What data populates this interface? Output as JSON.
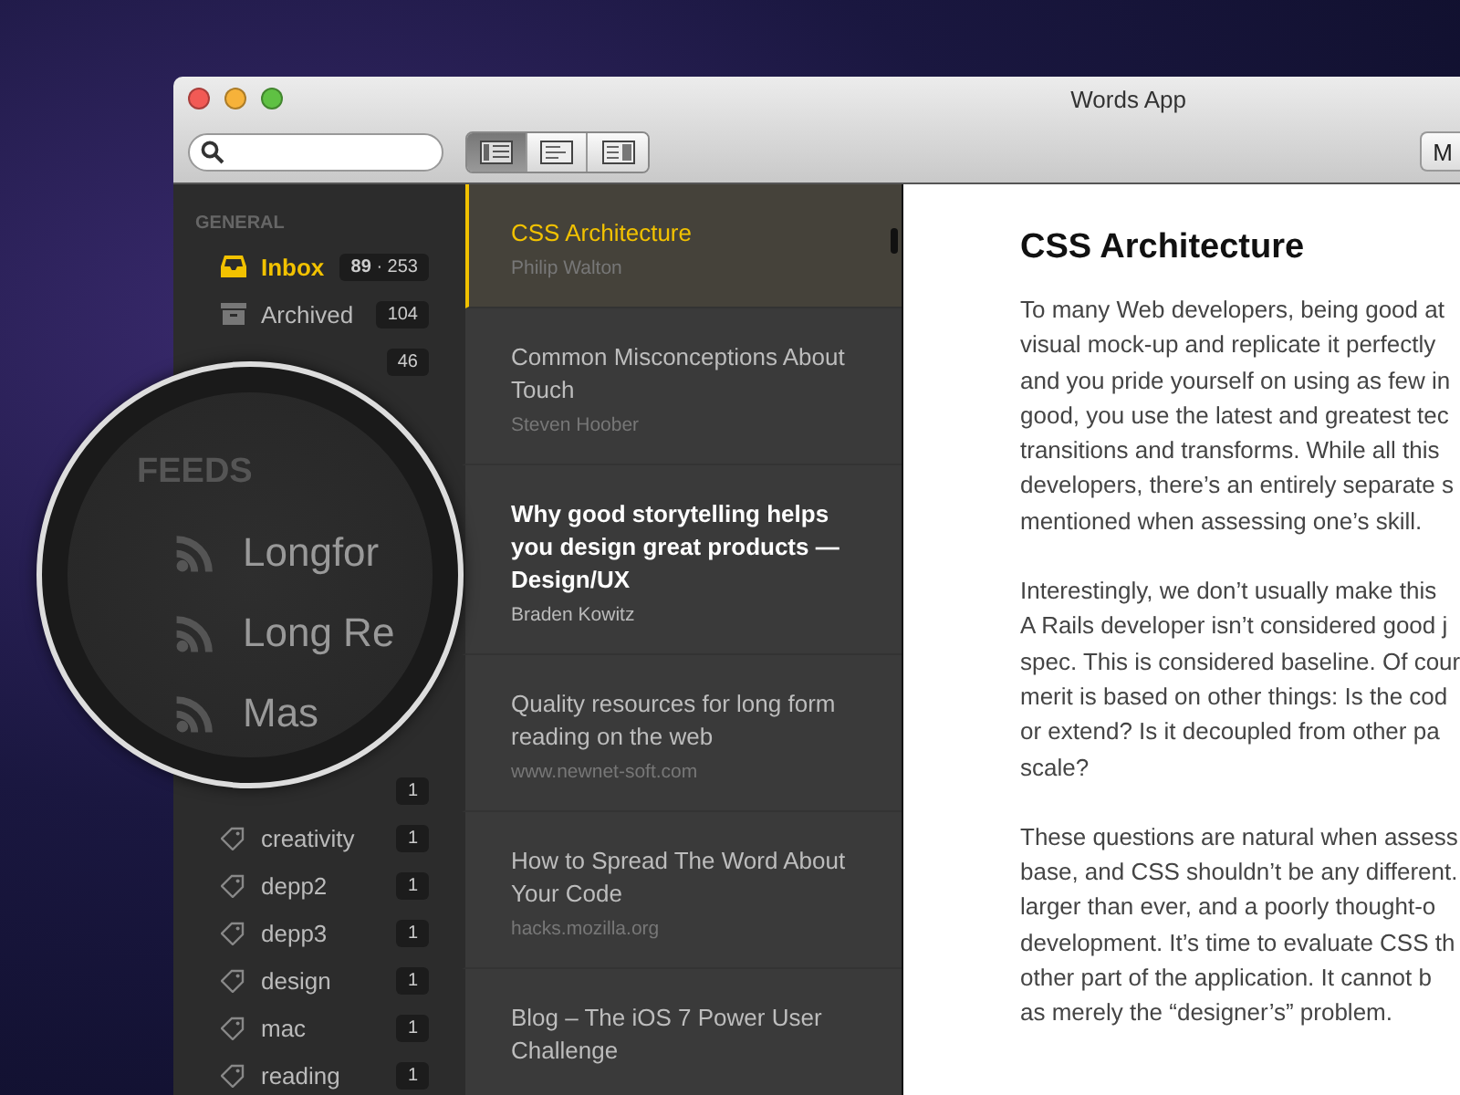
{
  "window": {
    "title": "Words App"
  },
  "toolbar": {
    "view_buttons": [
      {
        "kind": "list",
        "selected": true
      },
      {
        "kind": "preview",
        "selected": false
      },
      {
        "kind": "columns",
        "selected": false
      }
    ],
    "right_button": "M"
  },
  "sidebar": {
    "heading": "GENERAL",
    "items": [
      {
        "kind": "inbox",
        "label": "Inbox",
        "badge": "**89** · 253",
        "selected": true
      },
      {
        "kind": "archive",
        "label": "Archived",
        "badge": "104",
        "selected": false
      },
      {
        "badge": "46"
      }
    ],
    "tags": [
      {
        "badge": "1"
      },
      {
        "label": "creativity",
        "badge": "1"
      },
      {
        "label": "depp2",
        "badge": "1"
      },
      {
        "label": "depp3",
        "badge": "1"
      },
      {
        "label": "design",
        "badge": "1"
      },
      {
        "label": "mac",
        "badge": "1"
      },
      {
        "label": "reading",
        "badge": "1"
      }
    ]
  },
  "magnifier": {
    "heading": "FEEDS",
    "feeds": [
      "Longfor",
      "Long Re",
      "Mas"
    ]
  },
  "articles": [
    {
      "title": "CSS Architecture",
      "source": "Philip Walton",
      "selected": true,
      "unread": false
    },
    {
      "title": "Common Misconceptions About Touch",
      "source": "Steven Hoober",
      "selected": false,
      "unread": false
    },
    {
      "title": "Why good storytelling helps you design great products — Design/UX",
      "source": "Braden Kowitz",
      "selected": false,
      "unread": true
    },
    {
      "title": "Quality resources for long form reading on the web",
      "source": "www.newnet-soft.com",
      "selected": false,
      "unread": false
    },
    {
      "title": "How to Spread The Word About Your Code",
      "source": "hacks.mozilla.org",
      "selected": false,
      "unread": false
    },
    {
      "title": "Blog – The iOS 7 Power User Challenge",
      "selected": false,
      "unread": false
    }
  ],
  "reader": {
    "title": "CSS Architecture",
    "paragraphs": [
      [
        "To many Web developers, being good at",
        "visual mock-up and replicate it perfectly",
        "and you pride yourself on using as few in",
        "good, you use the latest and greatest tec",
        "transitions and transforms. While all this",
        "developers, there’s an entirely separate s",
        "mentioned when assessing one’s skill."
      ],
      [
        "Interestingly, we don’t usually make this",
        "A Rails developer isn’t considered good j",
        "spec. This is considered baseline. Of cour",
        "merit is based on other things: Is the cod",
        "or extend? Is it decoupled from other pa",
        "scale?"
      ],
      [
        "These questions are natural when assess",
        "base, and CSS shouldn’t be any different.",
        "larger than ever, and a poorly thought-o",
        "development. It’s time to evaluate CSS th",
        "other part of the application. It cannot b",
        "as merely the “designer’s” problem."
      ]
    ]
  }
}
